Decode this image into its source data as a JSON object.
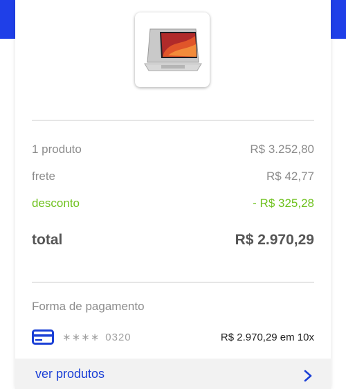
{
  "summary": {
    "products_label": "1 produto",
    "products_value": "R$ 3.252,80",
    "shipping_label": "frete",
    "shipping_value": "R$ 42,77",
    "discount_label": "desconto",
    "discount_value": "- R$ 325,28",
    "total_label": "total",
    "total_value": "R$ 2.970,29"
  },
  "payment": {
    "section_label": "Forma de pagamento",
    "card_mask": "∗∗∗∗",
    "card_last4": "0320",
    "amount": "R$ 2.970,29 em 10x"
  },
  "footer": {
    "link_label": "ver produtos"
  },
  "icons": {
    "card": "credit-card-icon",
    "chevron": "chevron-right-icon"
  },
  "colors": {
    "brand_blue": "#1f3fe8",
    "discount_green": "#6fc21f"
  }
}
